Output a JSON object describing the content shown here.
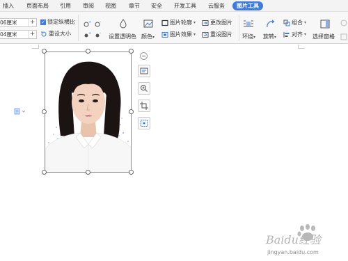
{
  "menubar": {
    "tabs": [
      {
        "label": "插入"
      },
      {
        "label": "页面布局"
      },
      {
        "label": "引用"
      },
      {
        "label": "审阅"
      },
      {
        "label": "视图"
      },
      {
        "label": "章节"
      },
      {
        "label": "安全"
      },
      {
        "label": "开发工具"
      },
      {
        "label": "云服务"
      },
      {
        "label": "图片工具"
      }
    ],
    "active_tab": "图片工具"
  },
  "ribbon": {
    "width_value": "06厘米",
    "height_value": "04厘米",
    "lock_ratio_label": "锁定纵横比",
    "reset_size_label": "重设大小",
    "transparent_label": "设置透明色",
    "color_label": "颜色",
    "outline_label": "图片轮廓",
    "effects_label": "图片效果",
    "change_label": "更改图片",
    "reset_pic_label": "重设图片",
    "wrap_label": "环绕",
    "rotate_label": "旋转",
    "group_label": "组合",
    "align_label": "对齐",
    "select_pane_label": "选择窗格"
  },
  "watermark": {
    "brand": "Baidu经验",
    "url": "jingyan.baidu.com"
  },
  "colors": {
    "accent": "#3d7be0",
    "ribbon_bg": "#f7f7f7",
    "menubar_bg": "#f3f3f3"
  }
}
